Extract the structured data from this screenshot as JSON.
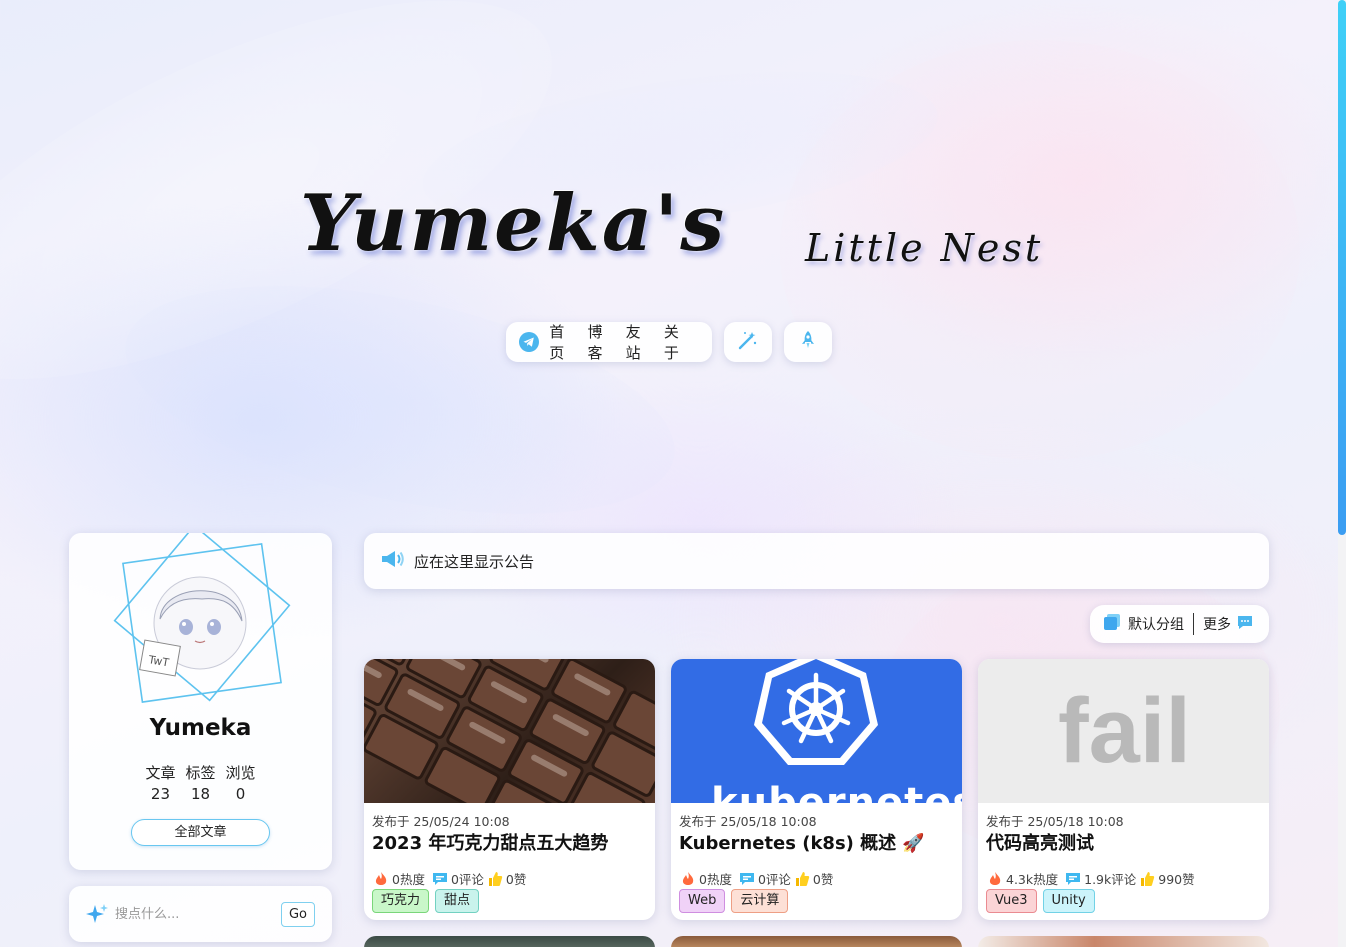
{
  "site": {
    "title_main": "Yumeka's",
    "title_sub": "Little Nest"
  },
  "nav": {
    "items": [
      "首页",
      "博客",
      "友站",
      "关于"
    ],
    "icons": [
      "telegram-plane-icon",
      "magic-wand-icon",
      "rocket-icon"
    ]
  },
  "profile": {
    "name": "Yumeka",
    "stats": [
      {
        "label": "文章",
        "value": "23"
      },
      {
        "label": "标签",
        "value": "18"
      },
      {
        "label": "浏览",
        "value": "0"
      }
    ],
    "all_posts_label": "全部文章"
  },
  "search": {
    "placeholder": "搜点什么...",
    "button_label": "Go"
  },
  "announcement": {
    "text": "应在这里显示公告"
  },
  "group": {
    "current": "默认分组",
    "more": "更多"
  },
  "posts": [
    {
      "date": "发布于 25/05/24 10:08",
      "title": "2023 年巧克力甜点五大趋势",
      "heat": "0热度",
      "comments": "0评论",
      "likes": "0赞",
      "tags": [
        {
          "label": "巧克力",
          "bg": "#c9f7c9",
          "border": "#7ad67a"
        },
        {
          "label": "甜点",
          "bg": "#c9f3ec",
          "border": "#72d1c1"
        }
      ]
    },
    {
      "date": "发布于 25/05/18 10:08",
      "title": "Kubernetes (k8s) 概述 🚀",
      "heat": "0热度",
      "comments": "0评论",
      "likes": "0赞",
      "image_text": "kubernetes",
      "tags": [
        {
          "label": "Web",
          "bg": "#f0d2f7",
          "border": "#cf8ee0"
        },
        {
          "label": "云计算",
          "bg": "#fde0d6",
          "border": "#ee9f85"
        }
      ]
    },
    {
      "date": "发布于 25/05/18 10:08",
      "title": "代码高亮测试",
      "heat": "4.3k热度",
      "comments": "1.9k评论",
      "likes": "990赞",
      "image_text": "fail",
      "tags": [
        {
          "label": "Vue3",
          "bg": "#fbd4d6",
          "border": "#ea8b91"
        },
        {
          "label": "Unity",
          "bg": "#ccf4fb",
          "border": "#72d2e6"
        }
      ]
    }
  ],
  "colors": {
    "accent": "#3fb8f0",
    "scrollbar_top": "#3fd0f7",
    "scrollbar_bottom": "#3b9df2",
    "k8s_blue": "#326ce5"
  }
}
